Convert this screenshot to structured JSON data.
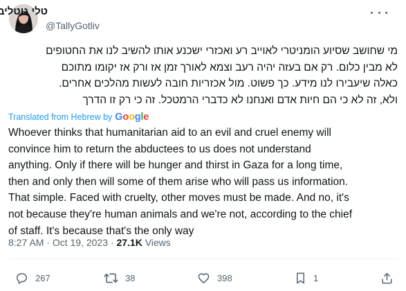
{
  "author": {
    "display_name": "טלי גוטליב",
    "handle": "@TallyGotliv",
    "avatar": "avatar-photo"
  },
  "tweet": {
    "original_lines": [
      "מי שחושב שסיוע הומניטרי לאוייב רע ואכזרי ישכנע אותו להשיב לנו את החטופים",
      "לא מבין כלום. רק אם בעזה יהיה רעב וצמא לאורך זמן אז ורק אז יקומו מתוכם",
      "כאלה שיעבירו לנו מידע. כך פשוט. מול אכזריות חובה לעשות מהלכים אחרים.",
      "ולא, זה לא כי הם חיות אדם ואנחנו לא כדברי הרמטכל. זה כי רק זו הדרך"
    ],
    "translation_label": "Translated from Hebrew by",
    "translation_provider": "Google",
    "translation_lines": [
      "Whoever thinks that humanitarian aid to an evil and cruel enemy will",
      "convince him to return the abductees to us does not understand",
      "anything. Only if there will be hunger and thirst in Gaza for a long time,",
      "then and only then will some of them arise who will pass us information.",
      "That simple. Faced with cruelty, other moves must be made. And no, it's",
      "not because they're human animals and we're not, according to the chief",
      "of staff. It's because that's the only way"
    ],
    "time": "8:27 AM",
    "separator": "·",
    "date": "Oct 19, 2023",
    "views_count": "27.1K",
    "views_label": "Views"
  },
  "actions": {
    "replies": "267",
    "retweets": "38",
    "likes": "398",
    "bookmarks": "1"
  },
  "colors": {
    "link": "#1d9bf0",
    "muted": "#536471",
    "text": "#0f1419",
    "divider": "#eff3f4"
  }
}
